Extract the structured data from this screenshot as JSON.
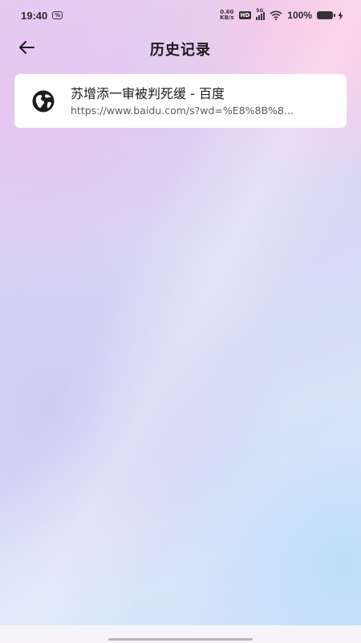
{
  "status_bar": {
    "time": "19:40",
    "network_speed_value": "0.60",
    "network_speed_unit": "KB/s",
    "hd_label": "HD",
    "signal_label": "5G",
    "battery_percent": "100%"
  },
  "header": {
    "title": "历史记录"
  },
  "history": {
    "items": [
      {
        "title": "苏增添一审被判死缓 - 百度",
        "url": "https://www.baidu.com/s?wd=%E8%8B%8…"
      }
    ]
  },
  "icons": {
    "back": "arrow-left",
    "history_item": "globe"
  },
  "colors": {
    "card_background": "#ffffff",
    "title_text": "#1a1a1a",
    "url_text": "#5a5a5a"
  }
}
